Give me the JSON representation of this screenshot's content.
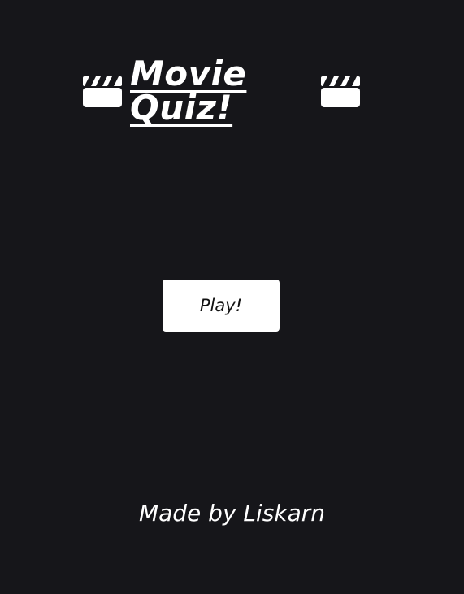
{
  "title": {
    "text": "Movie Quiz!",
    "icon_left": "clapperboard-icon",
    "icon_right": "clapperboard-icon"
  },
  "play_button": {
    "label": "Play!"
  },
  "footer": {
    "credit": "Made by Liskarn"
  },
  "colors": {
    "background": "#16161a",
    "text": "#ffffff",
    "button_bg": "#ffffff",
    "button_text": "#111111"
  }
}
